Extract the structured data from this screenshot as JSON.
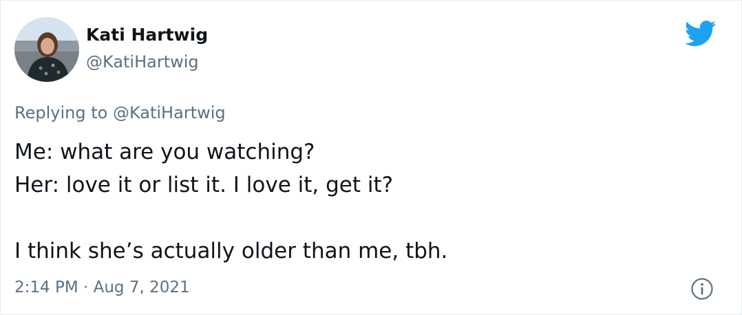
{
  "tweet": {
    "display_name": "Kati Hartwig",
    "handle": "@KatiHartwig",
    "replying_prefix": "Replying to",
    "replying_handle": "@KatiHartwig",
    "body_lines": [
      "Me: what are you watching?",
      "Her: love it or list it. I love it, get it?",
      "",
      "I think she’s actually older than me, tbh."
    ],
    "time": "2:14 PM",
    "separator": "·",
    "date": "Aug 7, 2021"
  },
  "icons": {
    "brand": "twitter-bird-icon",
    "info": "info-icon"
  },
  "colors": {
    "brand": "#1da1f2",
    "secondary_text": "#5b7083",
    "primary_text": "#0f1419"
  }
}
